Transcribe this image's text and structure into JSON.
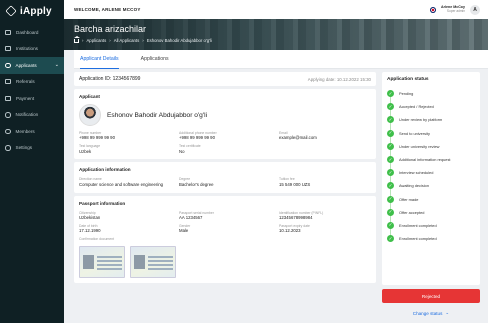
{
  "app": {
    "name": "iApply"
  },
  "sidebar": {
    "items": [
      {
        "label": "Dashboard",
        "icon": "grid-icon"
      },
      {
        "label": "Institutions",
        "icon": "building-icon"
      },
      {
        "label": "Applicants",
        "icon": "users-icon",
        "active": true
      },
      {
        "label": "Referrals",
        "icon": "share-icon"
      },
      {
        "label": "Payment",
        "icon": "card-icon"
      },
      {
        "label": "Notification",
        "icon": "bell-icon"
      },
      {
        "label": "Members",
        "icon": "people-icon"
      },
      {
        "label": "Settings",
        "icon": "gear-icon"
      }
    ]
  },
  "topbar": {
    "welcome": "WELCOME, ARLENE MCCOY",
    "user_name": "Arlene McCoy",
    "user_role": "Super admin",
    "avatar_initial": "A"
  },
  "hero": {
    "title": "Barcha arizachilar",
    "breadcrumb": [
      "Applicants",
      "All Applicants",
      "Eshonov Bahodir Abdujabbor o'g'li"
    ]
  },
  "tabs": [
    "Applicant Details",
    "Applications"
  ],
  "application": {
    "id_label": "Application ID: 1234567899",
    "date_label": "Applying date: 10.12.2022 15:30"
  },
  "applicant": {
    "section_title": "Applicant",
    "name": "Eshonov Bahodir Abdujabbor o'g'li",
    "fields": [
      {
        "label": "Phone number",
        "value": "+998 99 999 99 90"
      },
      {
        "label": "Additional phone number",
        "value": "+998 99 999 99 90"
      },
      {
        "label": "Email",
        "value": "example@mail.com"
      },
      {
        "label": "Test language",
        "value": "Uzbek"
      },
      {
        "label": "Test certificate",
        "value": "No"
      }
    ]
  },
  "application_info": {
    "section_title": "Application information",
    "fields": [
      {
        "label": "Direction name",
        "value": "Computer science and software engineering"
      },
      {
        "label": "Degree",
        "value": "Bachelor's degree"
      },
      {
        "label": "Tuition fee",
        "value": "15 549 000 UZS"
      }
    ]
  },
  "passport": {
    "section_title": "Passport information",
    "fields": [
      {
        "label": "Citizenship",
        "value": "Uzbekistan"
      },
      {
        "label": "Passport serial number",
        "value": "AA 1234567"
      },
      {
        "label": "Identification number (PINFL)",
        "value": "12345678998984"
      },
      {
        "label": "Date of birth",
        "value": "17.12.1990"
      },
      {
        "label": "Gender",
        "value": "Male"
      },
      {
        "label": "Passport expiry date",
        "value": "10.12.2023"
      }
    ],
    "doc_label": "Confirmation document"
  },
  "status": {
    "title": "Application status",
    "items": [
      "Pending",
      "Accepted / Rejected",
      "Under review by platform",
      "Send to university",
      "Under university review",
      "Additional information request",
      "Interview scheduled",
      "Awaiting decision",
      "Offer made",
      "Offer accepted",
      "Enrollment completed",
      "Enrollment completed"
    ],
    "check_color": "#3fbf4a"
  },
  "actions": {
    "reject_label": "Rejected",
    "change_label": "Change status"
  }
}
